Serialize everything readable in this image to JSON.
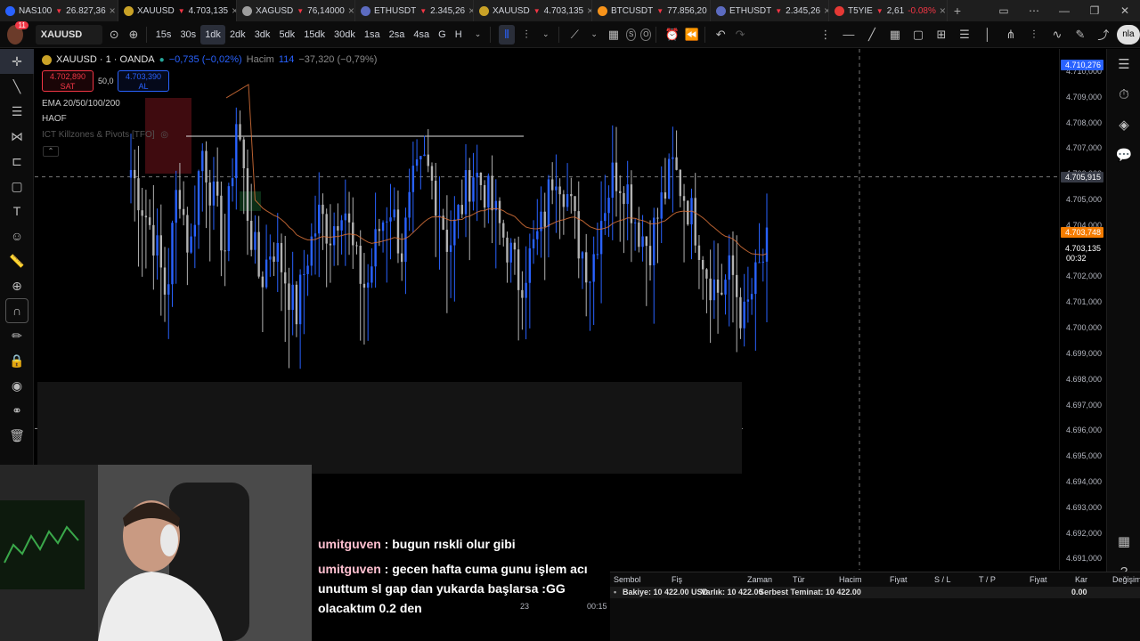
{
  "tabs": [
    {
      "symbol": "NAS100",
      "price": "26.827,36",
      "icon_color": "#2962ff",
      "active": false
    },
    {
      "symbol": "XAUUSD",
      "price": "4.703,135",
      "icon_color": "#c9a227",
      "active": true
    },
    {
      "symbol": "XAGUSD",
      "price": "76,14000",
      "icon_color": "#9e9e9e",
      "active": false
    },
    {
      "symbol": "ETHUSDT",
      "price": "2.345,26",
      "icon_color": "#5c6bc0",
      "active": false
    },
    {
      "symbol": "XAUUSD",
      "price": "4.703,135",
      "icon_color": "#c9a227",
      "active": false
    },
    {
      "symbol": "BTCUSDT",
      "price": "77.856,20",
      "icon_color": "#f7931a",
      "active": false
    },
    {
      "symbol": "ETHUSDT",
      "price": "2.345,26",
      "icon_color": "#5c6bc0",
      "active": false
    },
    {
      "symbol": "T5YIE",
      "price": "2,61",
      "pct": "-0.08%",
      "icon_color": "#e53935",
      "active": false
    }
  ],
  "toolbar": {
    "notification_count": "11",
    "symbol": "XAUUSD",
    "intervals": [
      "15s",
      "30s",
      "1dk",
      "2dk",
      "3dk",
      "5dk",
      "15dk",
      "30dk",
      "1sa",
      "2sa",
      "4sa",
      "G",
      "H"
    ],
    "active_interval": "1dk",
    "pill_s": "S",
    "pill_o": "O",
    "right_text": "nla"
  },
  "legend": {
    "title": "XAUUSD · 1 · OANDA",
    "change": "−0,735 (−0,02%)",
    "volume_label": "Hacim",
    "volume_value": "114",
    "volume_change": "−37,320 (−0,79%)",
    "sell_price": "4.702,890",
    "sell_label": "SAT",
    "spread": "50,0",
    "buy_price": "4.703,390",
    "buy_label": "AL",
    "indicator_1": "EMA 20/50/100/200",
    "indicator_2": "HAOF",
    "indicator_3": "ICT Killzones & Pivots [TFO]"
  },
  "price_axis": {
    "ticks": [
      "4.710,000",
      "4.709,000",
      "4.708,000",
      "4.707,000",
      "4.706,000",
      "4.705,000",
      "4.704,000",
      "4.703,000",
      "4.702,000",
      "4.701,000",
      "4.700,000",
      "4.699,000",
      "4.698,000",
      "4.697,000",
      "4.696,000",
      "4.695,000",
      "4.694,000",
      "4.693,000",
      "4.692,000",
      "4.691,000"
    ],
    "top_tag": "4.710,276",
    "crosshair_tag": "4.705,915",
    "ema_tag": "4.703,748",
    "last_price": "4.703,135",
    "countdown": "00:32",
    "accent_blue": "#2962ff",
    "accent_orange": "#f57c00"
  },
  "time_axis": {
    "label_a": "23",
    "label_b": "00:15"
  },
  "chat": [
    {
      "user": "umitguven",
      "text": ": bugun rıskli olur gibi"
    },
    {
      "user": "umitguven",
      "text": ": gecen hafta cuma gunu işlem acı unuttum sl gap dan yukarda başlarsa :GG olacaktım 0.2 den"
    }
  ],
  "trade_panel": {
    "headers": [
      "Sembol",
      "Fiş",
      "Zaman",
      "Tür",
      "Hacim",
      "Fiyat",
      "S / L",
      "T / P",
      "Fiyat",
      "Kar",
      "Değişim"
    ],
    "balance": "Bakiye: 10 422.00 USD",
    "equity": "Varlık: 10 422.00",
    "free_margin": "Serbest Teminat: 10 422.00",
    "profit": "0.00"
  },
  "chart_data": {
    "type": "candlestick",
    "ylim": [
      4690.6,
      4710.9
    ],
    "ema_color": "#d9723a",
    "up_color": "#2962ff",
    "down_color": "#b2b2b2",
    "values_approx": [
      4706.2,
      4704.8,
      4703.5,
      4701.2,
      4705.9,
      4702.8,
      4707.1,
      4705.0,
      4703.1,
      4708.4,
      4704.2,
      4701.8,
      4703.4,
      4702.2,
      4700.5,
      4702.9,
      4704.4,
      4703.7,
      4705.2,
      4702.6,
      4701.5,
      4703.8,
      4704.9,
      4703.0,
      4705.6,
      4706.4,
      4705.1,
      4703.2,
      4704.7,
      4706.2,
      4705.5,
      4704.3,
      4703.2,
      4701.8,
      4702.9,
      4704.1,
      4706.5,
      4705.3,
      4703.4,
      4702.2,
      4704.6,
      4706.1,
      4705.7,
      4704.0,
      4703.2,
      4704.8,
      4706.3,
      4705.2,
      4703.9,
      4702.1,
      4701.4,
      4702.3,
      4700.2,
      4701.8,
      4703.1
    ]
  }
}
